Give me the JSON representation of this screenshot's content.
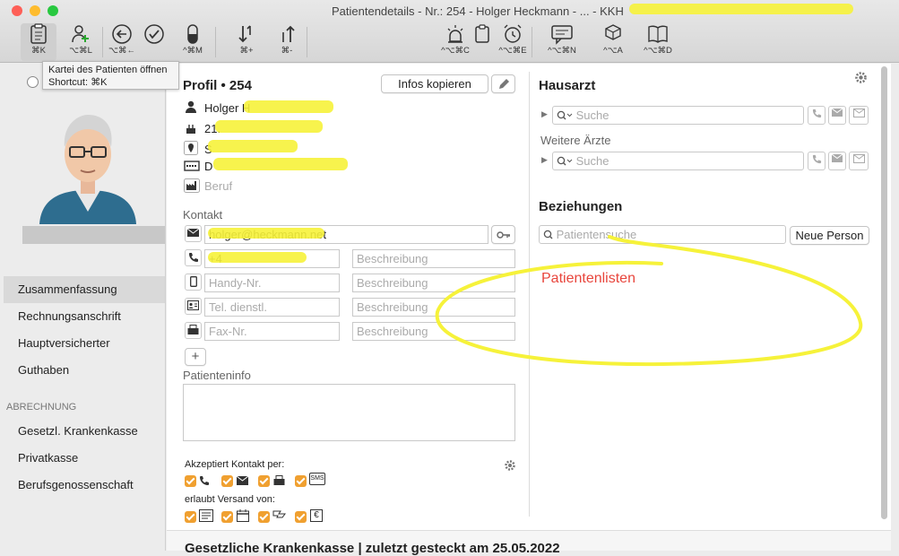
{
  "window": {
    "title": "Patientendetails - Nr.: 254 - Holger Heckmann - ... - KKH",
    "controls": {
      "close_color": "#fe5f57",
      "min_color": "#febc2e",
      "max_color": "#28c840"
    }
  },
  "toolbar": {
    "buttons": [
      {
        "icon": "clipboard-icon",
        "shortcut": "⌘K"
      },
      {
        "icon": "person-add-icon",
        "shortcut": "⌥⌘L"
      },
      {
        "icon": "back-arrow-icon",
        "shortcut": "⌥⌘←"
      },
      {
        "icon": "checkmark-circle-icon",
        "shortcut": ""
      },
      {
        "icon": "pill-icon",
        "shortcut": "^⌘M"
      },
      {
        "icon": "sort-down-icon",
        "shortcut": "⌘+"
      },
      {
        "icon": "sort-up-icon",
        "shortcut": "⌘-"
      },
      {
        "icon": "alarm-light-icon",
        "shortcut": "^⌥⌘C"
      },
      {
        "icon": "clipboard-edit-icon",
        "shortcut": ""
      },
      {
        "icon": "alarm-clock-icon",
        "shortcut": "^⌥⌘E"
      },
      {
        "icon": "message-icon",
        "shortcut": "^⌥⌘N"
      },
      {
        "icon": "cubes-icon",
        "shortcut": "^⌥A"
      },
      {
        "icon": "book-icon",
        "shortcut": "^⌥⌘D"
      }
    ]
  },
  "tooltip": {
    "line1": "Kartei des Patienten öffnen",
    "line2": "Shortcut: ⌘K"
  },
  "sidebar": {
    "items": [
      {
        "label": "Zusammenfassung",
        "selected": true
      },
      {
        "label": "Rechnungsanschrift"
      },
      {
        "label": "Hauptversicherter"
      },
      {
        "label": "Guthaben"
      }
    ],
    "section_abrechnung": "ABRECHNUNG",
    "billing_items": [
      {
        "label": "Gesetzl. Krankenkasse"
      },
      {
        "label": "Privatkasse"
      },
      {
        "label": "Berufsgenossenschaft"
      }
    ]
  },
  "profile": {
    "title": "Profil • 254",
    "copy_button": "Infos kopieren",
    "name": "Holger H",
    "birth": "21.",
    "street": "S",
    "city": "D",
    "beruf_placeholder": "Beruf"
  },
  "kontakt": {
    "label": "Kontakt",
    "email": "holger@heckmann.net",
    "phone": "+4",
    "handy_placeholder": "Handy-Nr.",
    "tel_dienstl_placeholder": "Tel. dienstl.",
    "fax_placeholder": "Fax-Nr.",
    "beschreibung_placeholder": "Beschreibung"
  },
  "patienteninfo": {
    "label": "Patienteninfo"
  },
  "akzeptiert": {
    "label": "Akzeptiert Kontakt per:",
    "sms_label": "SMS"
  },
  "versand": {
    "label": "erlaubt Versand von:",
    "euro_label": "€"
  },
  "hausarzt": {
    "title": "Hausarzt",
    "search_placeholder": "Suche",
    "weitere_label": "Weitere Ärzte",
    "weitere_placeholder": "Suche"
  },
  "beziehungen": {
    "title": "Beziehungen",
    "search_placeholder": "Patientensuche",
    "neue_person_button": "Neue Person"
  },
  "patientenlisten": {
    "label": "Patientenlisten",
    "color": "#e8453c"
  },
  "bottom": {
    "text": "Gesetzliche Krankenkasse | zuletzt gesteckt am 25.05.2022"
  }
}
